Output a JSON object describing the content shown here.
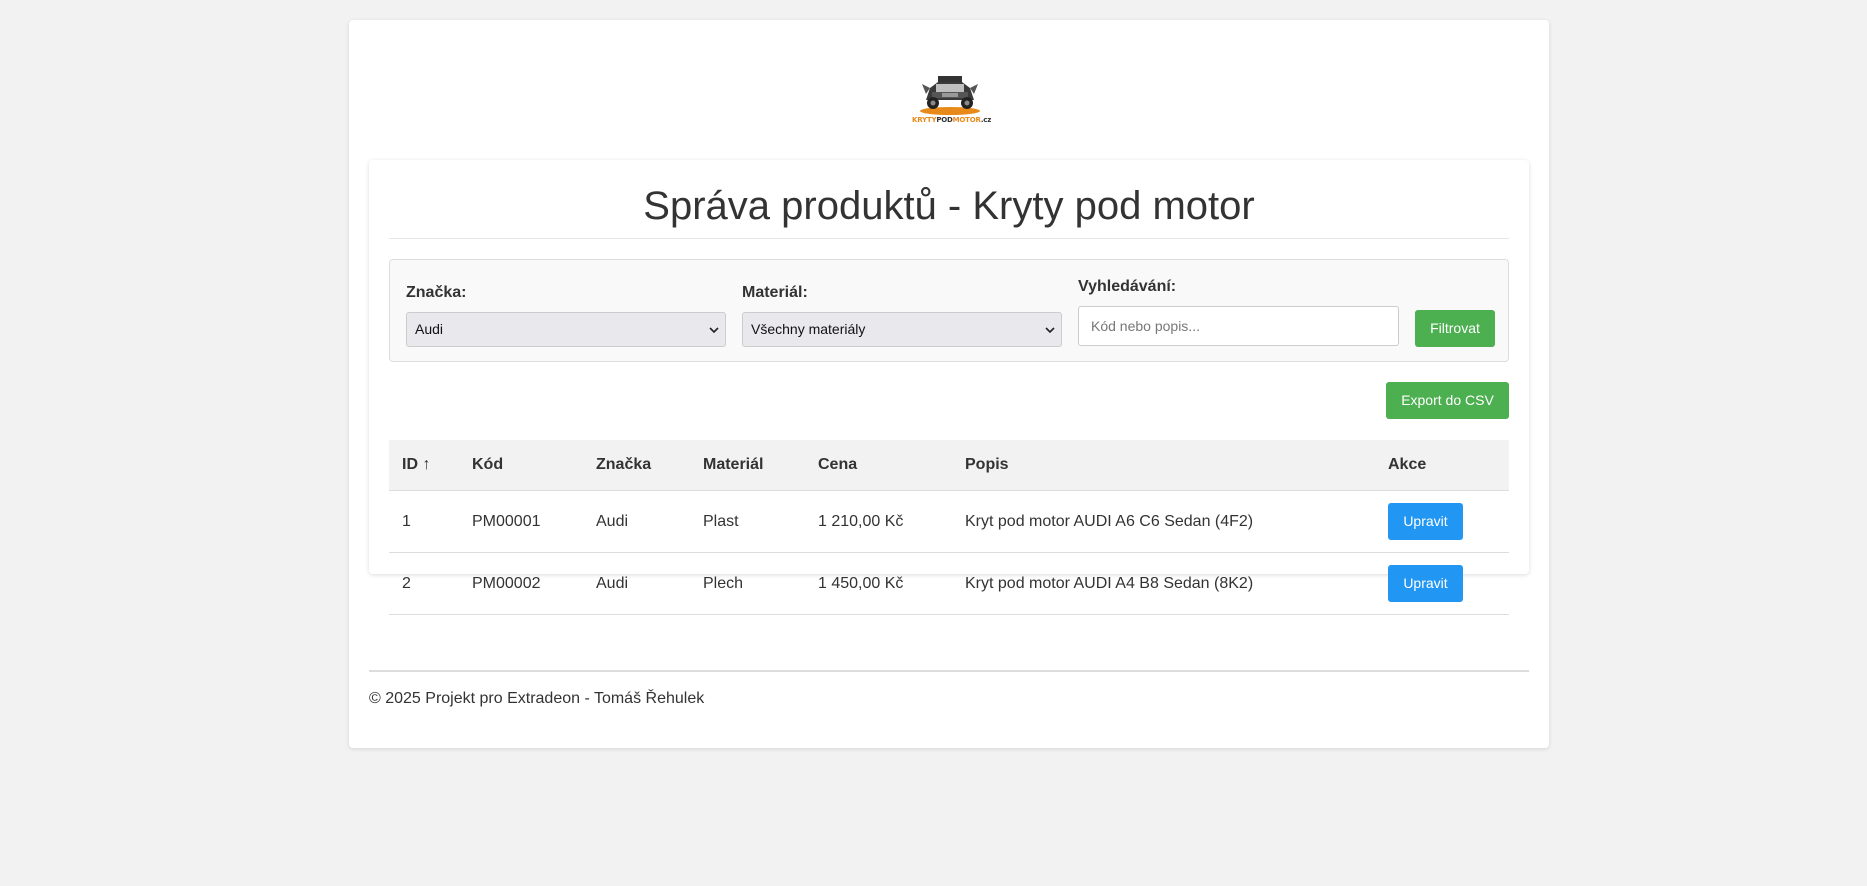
{
  "logo": {
    "text_orange": "KRYTY",
    "text_dark": "POD",
    "text_orange2": "MOTOR",
    "text_suffix": ".cz",
    "icon": "truck-logo-icon"
  },
  "page": {
    "title": "Správa produktů - Kryty pod motor"
  },
  "filters": {
    "brand_label": "Značka:",
    "brand_value": "Audi",
    "material_label": "Materiál:",
    "material_value": "Všechny materiály",
    "search_label": "Vyhledávání:",
    "search_placeholder": "Kód nebo popis...",
    "filter_button": "Filtrovat"
  },
  "export_button": "Export do CSV",
  "table": {
    "headers": [
      "ID ↑",
      "Kód",
      "Značka",
      "Materiál",
      "Cena",
      "Popis",
      "Akce"
    ],
    "rows": [
      {
        "id": "1",
        "code": "PM00001",
        "brand": "Audi",
        "material": "Plast",
        "price": "1 210,00 Kč",
        "description": "Kryt pod motor AUDI A6 C6 Sedan (4F2)",
        "action": "Upravit"
      },
      {
        "id": "2",
        "code": "PM00002",
        "brand": "Audi",
        "material": "Plech",
        "price": "1 450,00 Kč",
        "description": "Kryt pod motor AUDI A4 B8 Sedan (8K2)",
        "action": "Upravit"
      }
    ]
  },
  "footer": {
    "text": "© 2025 Projekt pro Extradeon - Tomáš Řehulek"
  },
  "colors": {
    "green": "#4caf50",
    "blue": "#2196f3",
    "background": "#f2f2f2"
  }
}
